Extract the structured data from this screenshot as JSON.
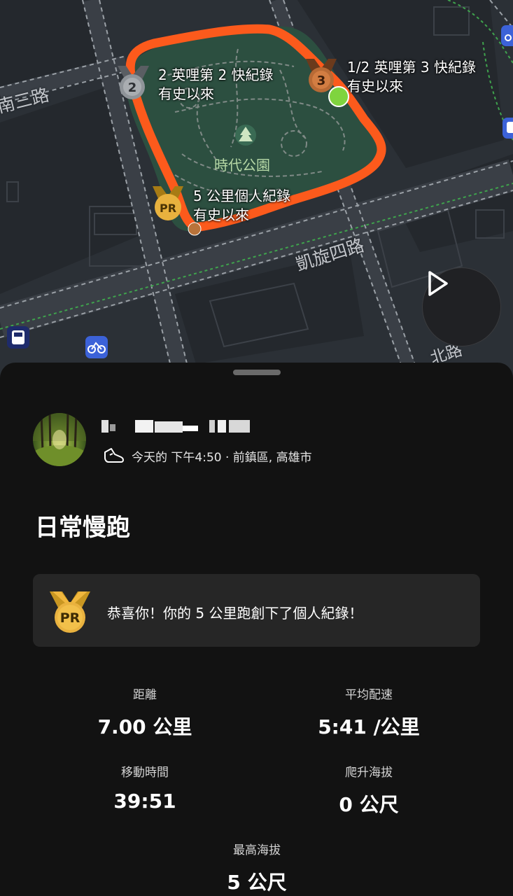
{
  "map": {
    "street_labels": [
      "南三路",
      "凱旋四路",
      "北路"
    ],
    "park_name": "時代公園",
    "annotations": [
      {
        "rank": "2",
        "title": "2 英哩第 2 快紀錄",
        "subtitle": "有史以來",
        "medal": "silver-medal-icon"
      },
      {
        "rank": "3",
        "title": "1/2 英哩第 3 快紀錄",
        "subtitle": "有史以來",
        "medal": "bronze-medal-icon"
      },
      {
        "rank": "PR",
        "title": "5 公里個人紀錄",
        "subtitle": "有史以來",
        "medal": "pr-medal-icon"
      }
    ],
    "colors": {
      "route": "#fc5a1c",
      "park": "#2c4f40",
      "start": "#7fd43e",
      "end": "#b9733a",
      "bronze": "#c9733b",
      "gold": "#f2c04a"
    }
  },
  "activity": {
    "time_location": "今天的 下午4:50 · 前鎮區, 高雄市",
    "title": "日常慢跑",
    "pr_message": "恭喜你！你的 5 公里跑創下了個人紀錄！",
    "pr_badge": "PR",
    "stats": [
      {
        "label": "距離",
        "value": "7.00 公里"
      },
      {
        "label": "平均配速",
        "value": "5:41 /公里"
      },
      {
        "label": "移動時間",
        "value": "39:51"
      },
      {
        "label": "爬升海拔",
        "value": "0 公尺"
      },
      {
        "label": "最高海拔",
        "value": "5 公尺"
      }
    ]
  }
}
